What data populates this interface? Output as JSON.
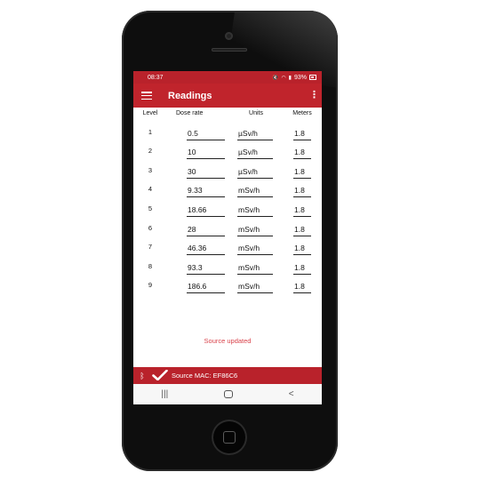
{
  "status_bar": {
    "time": "08:37",
    "battery": "93%"
  },
  "app_bar": {
    "title": "Readings",
    "menu_icon": "hamburger-icon",
    "overflow_icon": "more-vert-icon"
  },
  "table": {
    "headers": {
      "level": "Level",
      "dose": "Dose rate",
      "units": "Units",
      "meters": "Meters"
    },
    "rows": [
      {
        "level": "1",
        "dose": "0.5",
        "units": "µSv/h",
        "meters": "1.8"
      },
      {
        "level": "2",
        "dose": "10",
        "units": "µSv/h",
        "meters": "1.8"
      },
      {
        "level": "3",
        "dose": "30",
        "units": "µSv/h",
        "meters": "1.8"
      },
      {
        "level": "4",
        "dose": "9.33",
        "units": "mSv/h",
        "meters": "1.8"
      },
      {
        "level": "5",
        "dose": "18.66",
        "units": "mSv/h",
        "meters": "1.8"
      },
      {
        "level": "6",
        "dose": "28",
        "units": "mSv/h",
        "meters": "1.8"
      },
      {
        "level": "7",
        "dose": "46.36",
        "units": "mSv/h",
        "meters": "1.8"
      },
      {
        "level": "8",
        "dose": "93.3",
        "units": "mSv/h",
        "meters": "1.8"
      },
      {
        "level": "9",
        "dose": "186.6",
        "units": "mSv/h",
        "meters": "1.8"
      }
    ]
  },
  "toast": "Source updated",
  "source_bar": {
    "label": "Source MAC: EF86C6",
    "bluetooth_icon": "bluetooth-icon",
    "check_icon": "check-icon"
  },
  "colors": {
    "primary": "#c0242c",
    "status": "#b9222b",
    "toast": "#d9434b"
  }
}
